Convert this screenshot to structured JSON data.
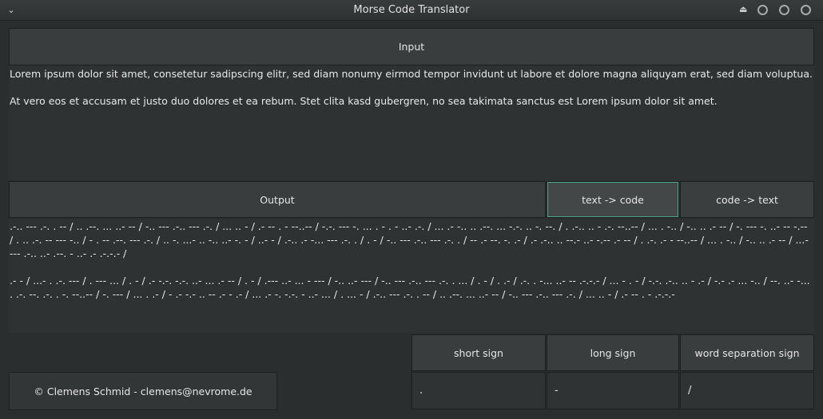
{
  "window": {
    "title": "Morse Code Translator",
    "menu_icon": "chevron-down-icon",
    "eject_icon": "eject-icon"
  },
  "input": {
    "header": "Input",
    "paragraphs": [
      "Lorem ipsum dolor sit amet, consetetur sadipscing elitr, sed diam nonumy eirmod tempor invidunt ut labore et dolore magna aliquyam erat, sed diam voluptua.",
      "At vero eos et accusam et justo duo dolores et ea rebum. Stet clita kasd gubergren, no sea takimata sanctus est Lorem ipsum dolor sit amet."
    ]
  },
  "output": {
    "header": "Output",
    "text_to_code_label": "text -> code",
    "code_to_text_label": "code -> text",
    "paragraphs": [
      ".-.. --- .-. . -- / .. .--. ... ..- -- / -.. --- .-.. --- .-. / ... .. - / .- -- . - --..-- / -.-. --- -. ... . - . - ..- .-. / ... .- -.. .. .--. ... -.-. .. -. --. / . .-.. .. - .-. --..-- / ... . -.. / -.. .. .- -- / -. --- -. ..- -- -.-- / . .. .-. -- --- -.. / - . -- .--. --- .-. / .. -. ...- .. -.. ..- -. - / ..- - / .-.. .- -... --- .-. . / . - / -.. --- .-.. --- .-. . / -- .- --. -. .- / .- .-.. .. --.- ..- -.-- .- -- / . .-. .- - --..-- / ... . -.. / -.. .. .- -- / ...- --- .-.. ..- .--. - ..- .- .-.-.- /",
      ".- - / ...- . .-. --- / . --- ... / . - / .- -.-. -.-. ..- ... .- -- / . - / .--- ..- ... - --- / -.. ..- --- / -.. --- .-.. --- .-. . ... / . - / . .- / .-. . -... ..- -- .-.-.- / ... - . - / -.-. .-.. .. - .- / -.- .- ... -.. / --. ..- -... . .-. --. .-. . -. --..-- / -. --- / ... . .- / - .- -.- .. -- .- - .- / ... .- -. -.-. - ..- ... / . ... - / .-.. --- .-. . -- / .. .--. ... ..- -- / -.. --- .-.. --- .-. / ... .. - / .- -- . - .-.-.-"
    ]
  },
  "settings": {
    "short_sign_label": "short sign",
    "long_sign_label": "long sign",
    "word_sep_label": "word separation sign",
    "short_sign_value": ".",
    "long_sign_value": "-",
    "word_sep_value": "/"
  },
  "footer": {
    "credit": "© Clemens Schmid - clemens@nevrome.de"
  }
}
